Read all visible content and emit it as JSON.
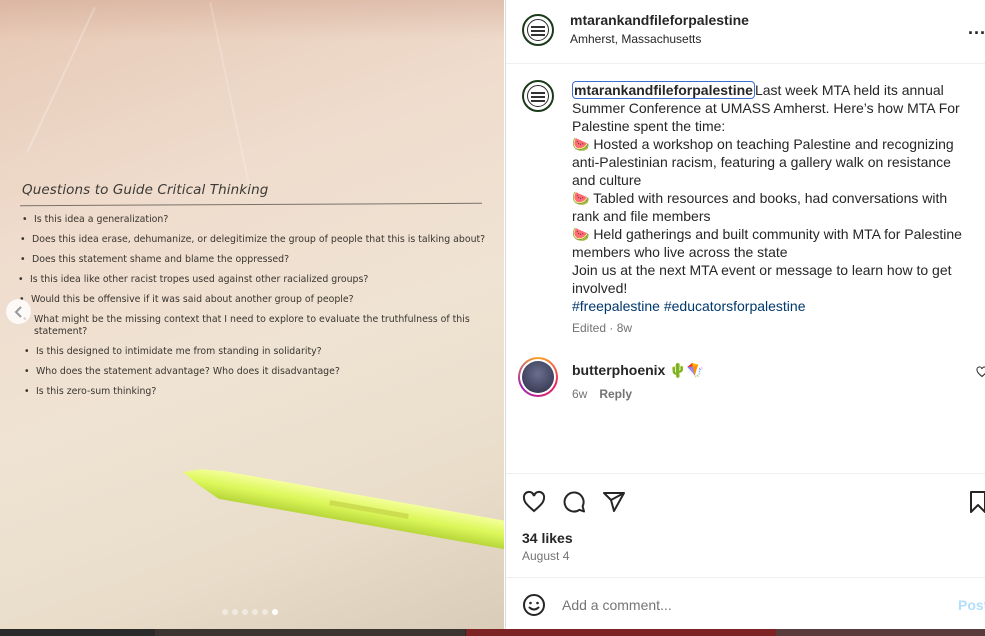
{
  "photo": {
    "doc_title": "Questions to Guide Critical Thinking",
    "questions": [
      "Is this idea a generalization?",
      "Does this idea erase, dehumanize, or delegitimize the group of people that this is talking about?",
      "Does this statement shame and blame the oppressed?",
      "Is this idea like other racist tropes used against other racialized groups?",
      "Would this be offensive if it was said about another group of people?",
      "What might be the missing context that I need to explore to evaluate the truthfulness of this statement?",
      "Is this designed to intimidate me from standing in solidarity?",
      "Who does the statement advantage? Who does it disadvantage?",
      "Is this zero-sum thinking?"
    ],
    "carousel_total": 6,
    "carousel_active": 6
  },
  "header": {
    "username": "mtarankandfileforpalestine",
    "location": "Amherst, Massachusetts",
    "more_label": "..."
  },
  "caption": {
    "mention": "mtarankandfileforpalestine",
    "line1": "Last week MTA held its annual Summer Conference at UMASS Amherst. Here’s how MTA For Palestine spent the time:",
    "bullet1": "🍉 Hosted a workshop on teaching Palestine and recognizing anti-Palestinian racism, featuring a gallery walk on resistance and culture",
    "bullet2": "🍉 Tabled with resources and books, had conversations with rank and file members",
    "bullet3": "🍉 Held gatherings and built community with MTA for Palestine members who live across the state",
    "closing": "Join us at the next MTA event or message to learn how to get involved!",
    "hashtag1": "#freepalestine",
    "hashtag2": "#educatorsforpalestine",
    "meta": "Edited · 8w"
  },
  "comment": {
    "username": "butterphoenix 🌵🪁",
    "time": "6w",
    "reply_label": "Reply"
  },
  "actions": {
    "likes": "34 likes",
    "date": "August 4"
  },
  "comment_box": {
    "placeholder": "Add a comment...",
    "post_label": "Post"
  }
}
